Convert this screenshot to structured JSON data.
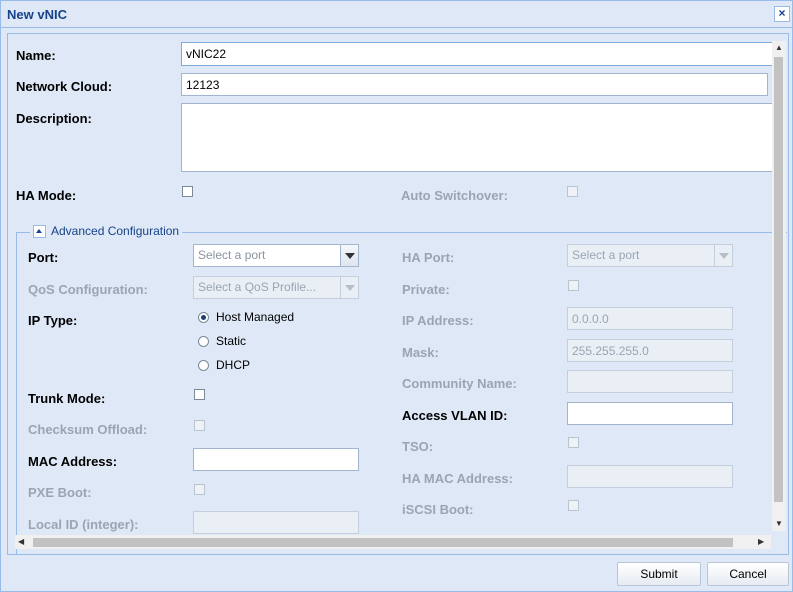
{
  "window": {
    "title": "New vNIC"
  },
  "form": {
    "name_label": "Name:",
    "name_value": "vNIC22",
    "cloud_label": "Network Cloud:",
    "cloud_value": "12123",
    "desc_label": "Description:",
    "desc_value": "",
    "ha_mode_label": "HA Mode:",
    "auto_switchover_label": "Auto Switchover:"
  },
  "advanced": {
    "legend": "Advanced Configuration",
    "port_label": "Port:",
    "port_placeholder": "Select a port",
    "qos_label": "QoS Configuration:",
    "qos_placeholder": "Select a QoS Profile...",
    "ip_type_label": "IP Type:",
    "ip_types": [
      "Host Managed",
      "Static",
      "DHCP"
    ],
    "ip_type_selected": "Host Managed",
    "trunk_label": "Trunk Mode:",
    "checksum_label": "Checksum Offload:",
    "mac_label": "MAC Address:",
    "mac_value": "",
    "pxe_label": "PXE Boot:",
    "local_id_label": "Local ID (integer):",
    "local_id_value": "",
    "ha_port_label": "HA Port:",
    "ha_port_placeholder": "Select a port",
    "private_label": "Private:",
    "ip_address_label": "IP Address:",
    "ip_address_value": "0.0.0.0",
    "mask_label": "Mask:",
    "mask_value": "255.255.255.0",
    "community_label": "Community Name:",
    "community_value": "",
    "vlan_label": "Access VLAN ID:",
    "vlan_value": "",
    "tso_label": "TSO:",
    "ha_mac_label": "HA MAC Address:",
    "ha_mac_value": "",
    "iscsi_label": "iSCSI Boot:"
  },
  "buttons": {
    "submit": "Submit",
    "cancel": "Cancel"
  },
  "colors": {
    "title": "#15428b",
    "panel_bg": "#dfe8f6",
    "border": "#99bbe8"
  }
}
